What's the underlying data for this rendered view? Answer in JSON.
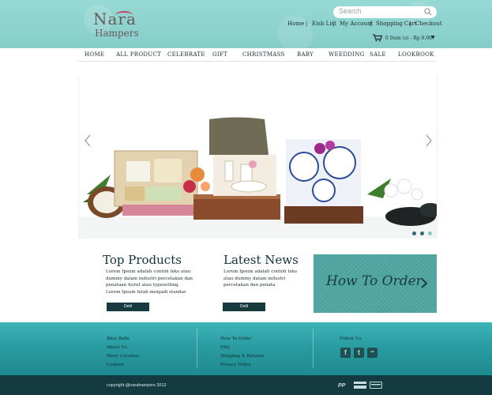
{
  "logo": {
    "line1": "Nara",
    "line2": "Hampers"
  },
  "search": {
    "placeholder": "Search"
  },
  "toplinks": {
    "home": "Home",
    "wish": "Eish List",
    "account": "My Account",
    "cart": "Shopping Cart",
    "checkout": "Checkout",
    "sep": "|"
  },
  "cart": {
    "text": "0 Item (s)  -  Rp 0.00",
    "caret": "▼"
  },
  "nav": [
    "HOME",
    "ALL PRODUCT",
    "CELEBRATE",
    "GIFT",
    "CHRISTMASS",
    "BABY",
    "WEEDDING",
    "SALE",
    "LOOKBOOK"
  ],
  "slider": {
    "active_slide": 2,
    "slide_count": 3
  },
  "top_products": {
    "title": "Top Products",
    "text": "Lorem Ipsum adalah contoh teks atau dummy dalam industri percetakan dan penataan huruf atau typesetting. Lorem Ipsum telah menjadi standar",
    "button": "Detil"
  },
  "latest_news": {
    "title": "Latest News",
    "text": "Lorem Ipsum adalah contoh teks atau dummy dalam industri percetakan dan penata",
    "button": "Detil"
  },
  "how_to_order": {
    "text": "How To Order"
  },
  "footer": {
    "col1": [
      "Bliss Bells",
      "About Us",
      "Store Location",
      "Contact"
    ],
    "col2": [
      "How To Order",
      "FAQ",
      "Shipping & Returns",
      "Privacy Policy"
    ],
    "follow": "Follow Us",
    "social": [
      "f",
      "t",
      "••"
    ],
    "copyright": "copyright @narahampers 2012",
    "payment": [
      "PayPal",
      "VISA",
      "Card"
    ]
  },
  "colors": {
    "teal": "#8fd3cf",
    "dark": "#143b40",
    "accent": "#c8416a"
  }
}
